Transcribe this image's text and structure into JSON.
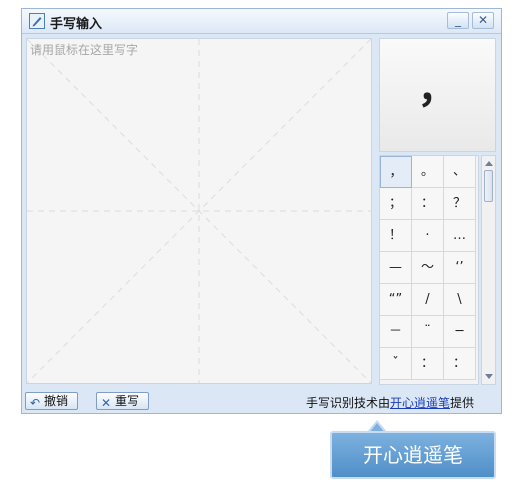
{
  "window": {
    "title": "手写输入",
    "minimize_glyph": "_",
    "close_glyph": "✕"
  },
  "canvas": {
    "hint": "请用鼠标在这里写字"
  },
  "preview": {
    "char": "，"
  },
  "candidates": [
    "，",
    "。",
    "、",
    "；",
    "：",
    "？",
    "！",
    "·",
    "…",
    "—",
    "～",
    "‘’",
    "“”",
    "/",
    "\\",
    "－",
    "¨",
    "─",
    "ˇ",
    "：",
    "："
  ],
  "footer": {
    "undo_label": "撤销",
    "rewrite_label": "重写",
    "credit_prefix": "手写识别技术由",
    "credit_link": "开心逍遥笔",
    "credit_suffix": "提供"
  },
  "tooltip": {
    "text": "开心逍遥笔"
  }
}
